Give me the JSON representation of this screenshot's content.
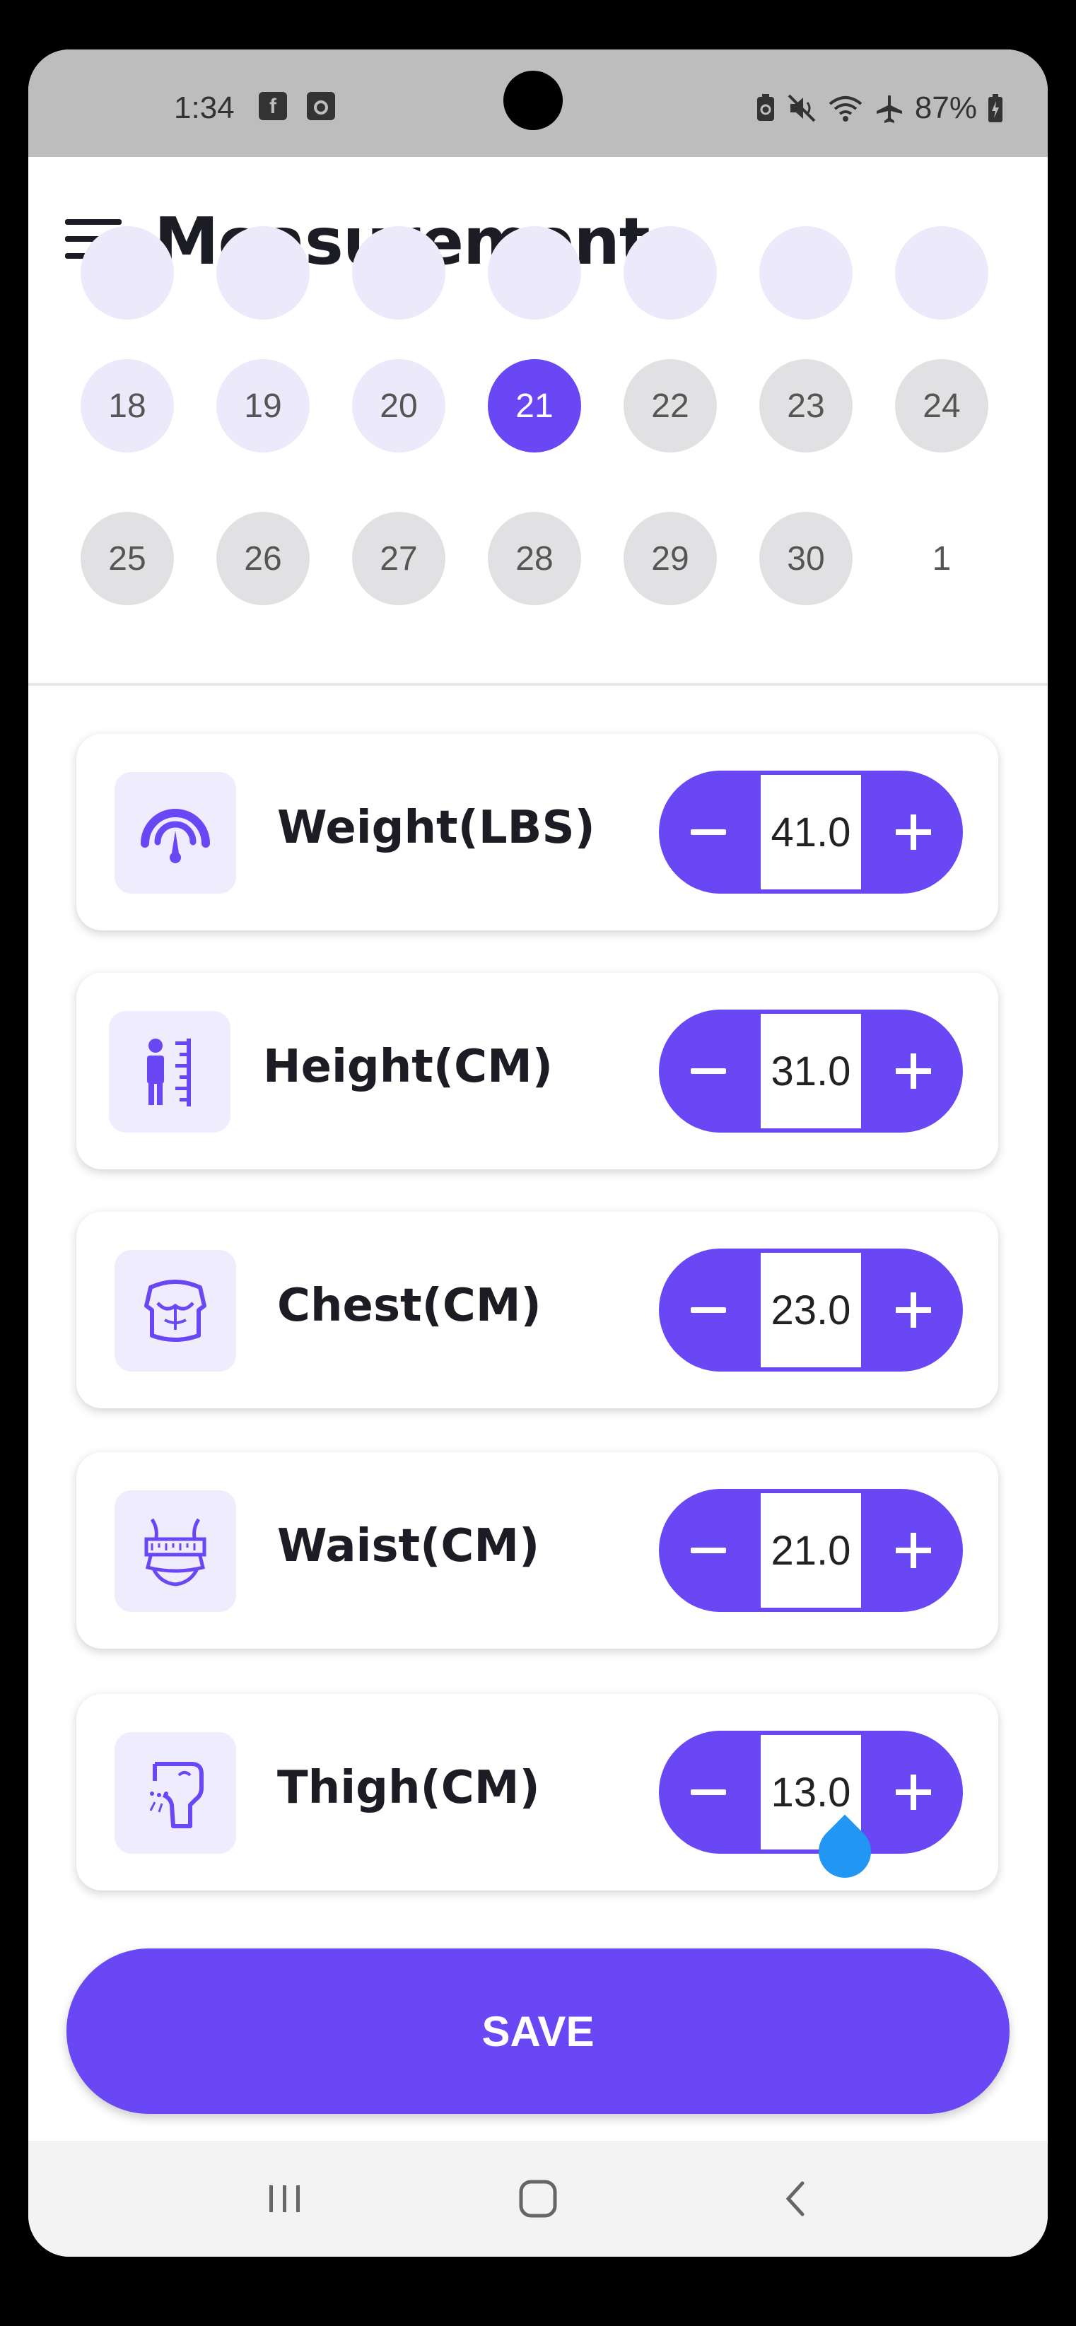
{
  "status_bar": {
    "time": "1:34",
    "notification_icons": [
      "facebook-icon",
      "media-icon"
    ],
    "right_icons": [
      "battery-saver-icon",
      "mute-icon",
      "wifi-icon",
      "airplane-mode-icon"
    ],
    "battery_percent": "87%"
  },
  "app_bar": {
    "title": "Measurement"
  },
  "calendar": {
    "row1": [
      "18",
      "19",
      "20",
      "21",
      "22",
      "23",
      "24"
    ],
    "row2": [
      "25",
      "26",
      "27",
      "28",
      "29",
      "30",
      "1"
    ],
    "selected_day": "21"
  },
  "measurements": [
    {
      "label": "Weight(LBS)",
      "value": "41.0",
      "icon": "weight-scale-icon"
    },
    {
      "label": "Height(CM)",
      "value": "31.0",
      "icon": "height-ruler-icon"
    },
    {
      "label": "Chest(CM)",
      "value": "23.0",
      "icon": "chest-icon"
    },
    {
      "label": "Waist(CM)",
      "value": "21.0",
      "icon": "waist-tape-icon"
    },
    {
      "label": "Thigh(CM)",
      "value": "13.0",
      "icon": "thigh-icon"
    }
  ],
  "save_label": "SAVE",
  "colors": {
    "accent": "#6a47f4",
    "light_accent": "#ece9fb",
    "text_dark": "#1c1c24",
    "cursor_handle": "#2196f3"
  },
  "nav_bar": [
    "recent-apps-icon",
    "home-icon",
    "back-icon"
  ]
}
